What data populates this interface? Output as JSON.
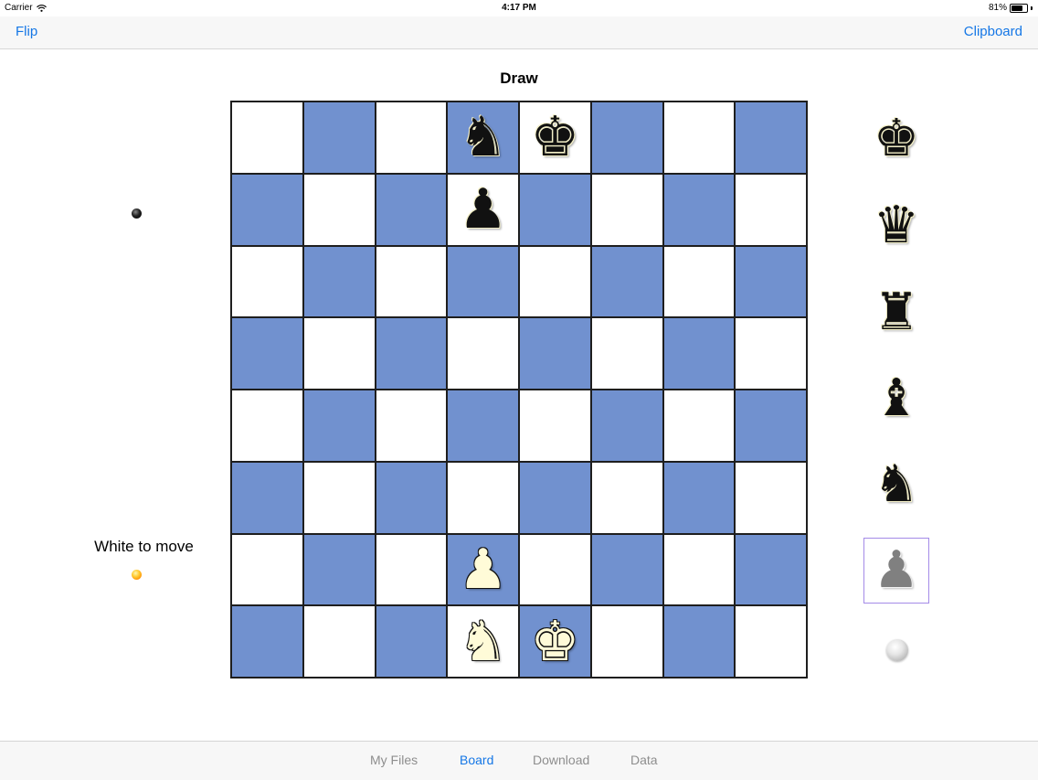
{
  "status_bar": {
    "carrier": "Carrier",
    "time": "4:17 PM",
    "battery": "81%",
    "battery_level": 0.81
  },
  "nav": {
    "left_button": "Flip",
    "right_button": "Clipboard"
  },
  "board": {
    "title": "Draw",
    "light_color": "#ffffff",
    "dark_color": "#7191cf",
    "rows": [
      [
        "",
        "",
        "",
        "n",
        "k",
        "",
        "",
        ""
      ],
      [
        "",
        "",
        "",
        "p",
        "",
        "",
        "",
        ""
      ],
      [
        "",
        "",
        "",
        "",
        "",
        "",
        "",
        ""
      ],
      [
        "",
        "",
        "",
        "",
        "",
        "",
        "",
        ""
      ],
      [
        "",
        "",
        "",
        "",
        "",
        "",
        "",
        ""
      ],
      [
        "",
        "",
        "",
        "",
        "",
        "",
        "",
        ""
      ],
      [
        "",
        "",
        "",
        "P",
        "",
        "",
        "",
        ""
      ],
      [
        "",
        "",
        "",
        "N",
        "K",
        "",
        "",
        ""
      ]
    ]
  },
  "turn": {
    "label": "White to move",
    "side": "white"
  },
  "palette": {
    "items": [
      {
        "piece": "king",
        "icon": "black-king-icon",
        "glyph": "♚"
      },
      {
        "piece": "queen",
        "icon": "black-queen-icon",
        "glyph": "♛"
      },
      {
        "piece": "rook",
        "icon": "black-rook-icon",
        "glyph": "♜"
      },
      {
        "piece": "bishop",
        "icon": "black-bishop-icon",
        "glyph": "♝"
      },
      {
        "piece": "knight",
        "icon": "black-knight-icon",
        "glyph": "♞"
      },
      {
        "piece": "pawn",
        "icon": "pawn-icon-selected",
        "glyph": "♟",
        "selected": true
      }
    ],
    "color_toggle_icon": "piece-color-toggle-icon"
  },
  "tabs": [
    {
      "label": "My Files",
      "active": false
    },
    {
      "label": "Board",
      "active": true
    },
    {
      "label": "Download",
      "active": false
    },
    {
      "label": "Data",
      "active": false
    }
  ],
  "colors": {
    "accent": "#1577e6",
    "selection": "#a48be8"
  }
}
